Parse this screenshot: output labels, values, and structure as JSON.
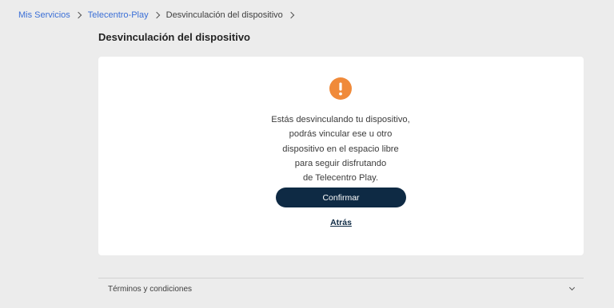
{
  "breadcrumb": {
    "items": [
      {
        "label": "Mis Servicios"
      },
      {
        "label": "Telecentro-Play"
      },
      {
        "label": "Desvinculación del dispositivo"
      }
    ]
  },
  "page": {
    "title": "Desvinculación del dispositivo"
  },
  "card": {
    "icon": "exclamation-icon",
    "icon_color": "#f08a3a",
    "message_lines": [
      "Estás desvinculando tu dispositivo,",
      "podrás vincular ese u otro",
      "dispositivo en el espacio libre",
      "para seguir disfrutando",
      "de Telecentro Play."
    ],
    "confirm_label": "Confirmar",
    "confirm_color": "#0e2a44",
    "back_label": "Atrás"
  },
  "footer": {
    "terms_label": "Términos y condiciones"
  }
}
